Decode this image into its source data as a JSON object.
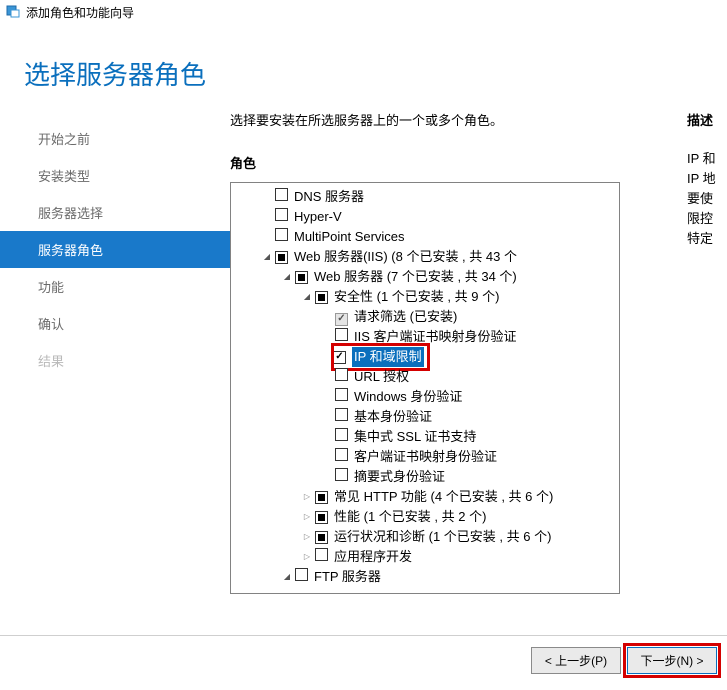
{
  "window": {
    "title": "添加角色和功能向导"
  },
  "page": {
    "title": "选择服务器角色"
  },
  "sidebar": {
    "items": [
      {
        "label": "开始之前"
      },
      {
        "label": "安装类型"
      },
      {
        "label": "服务器选择"
      },
      {
        "label": "服务器角色"
      },
      {
        "label": "功能"
      },
      {
        "label": "确认"
      },
      {
        "label": "结果"
      }
    ]
  },
  "main": {
    "instruction": "选择要安装在所选服务器上的一个或多个角色。",
    "roles_label": "角色"
  },
  "tree": [
    {
      "level": 0,
      "exp": "none",
      "chk": "empty",
      "label": "DNS 服务器"
    },
    {
      "level": 0,
      "exp": "none",
      "chk": "empty",
      "label": "Hyper-V"
    },
    {
      "level": 0,
      "exp": "none",
      "chk": "empty",
      "label": "MultiPoint Services"
    },
    {
      "level": 0,
      "exp": "expanded",
      "chk": "mixed",
      "label": "Web 服务器(IIS) (8 个已安装 , 共 43 个"
    },
    {
      "level": 1,
      "exp": "expanded",
      "chk": "mixed",
      "label": "Web 服务器 (7 个已安装 , 共 34 个)"
    },
    {
      "level": 2,
      "exp": "expanded",
      "chk": "mixed",
      "label": "安全性 (1 个已安装 , 共 9 个)"
    },
    {
      "level": 3,
      "exp": "none",
      "chk": "checked",
      "disabled": true,
      "label": "请求筛选 (已安装)"
    },
    {
      "level": 3,
      "exp": "none",
      "chk": "empty",
      "label": "IIS 客户端证书映射身份验证"
    },
    {
      "level": 3,
      "exp": "none",
      "chk": "checked",
      "label": "IP 和域限制",
      "selected": true,
      "highlight": true
    },
    {
      "level": 3,
      "exp": "none",
      "chk": "empty",
      "label": "URL 授权"
    },
    {
      "level": 3,
      "exp": "none",
      "chk": "empty",
      "label": "Windows 身份验证"
    },
    {
      "level": 3,
      "exp": "none",
      "chk": "empty",
      "label": "基本身份验证"
    },
    {
      "level": 3,
      "exp": "none",
      "chk": "empty",
      "label": "集中式 SSL 证书支持"
    },
    {
      "level": 3,
      "exp": "none",
      "chk": "empty",
      "label": "客户端证书映射身份验证"
    },
    {
      "level": 3,
      "exp": "none",
      "chk": "empty",
      "label": "摘要式身份验证"
    },
    {
      "level": 2,
      "exp": "collapsed",
      "chk": "mixed",
      "label": "常见 HTTP 功能 (4 个已安装 , 共 6 个)"
    },
    {
      "level": 2,
      "exp": "collapsed",
      "chk": "mixed",
      "label": "性能 (1 个已安装 , 共 2 个)"
    },
    {
      "level": 2,
      "exp": "collapsed",
      "chk": "mixed",
      "label": "运行状况和诊断 (1 个已安装 , 共 6 个)"
    },
    {
      "level": 2,
      "exp": "collapsed",
      "chk": "empty",
      "label": "应用程序开发"
    },
    {
      "level": 1,
      "exp": "expanded",
      "chk": "empty",
      "label": "FTP 服务器"
    }
  ],
  "right": {
    "desc_label": "描述",
    "lines": [
      "IP 和",
      "IP 地",
      "要使",
      "限控",
      "特定"
    ]
  },
  "footer": {
    "prev": "< 上一步(P)",
    "next": "下一步(N) >"
  }
}
